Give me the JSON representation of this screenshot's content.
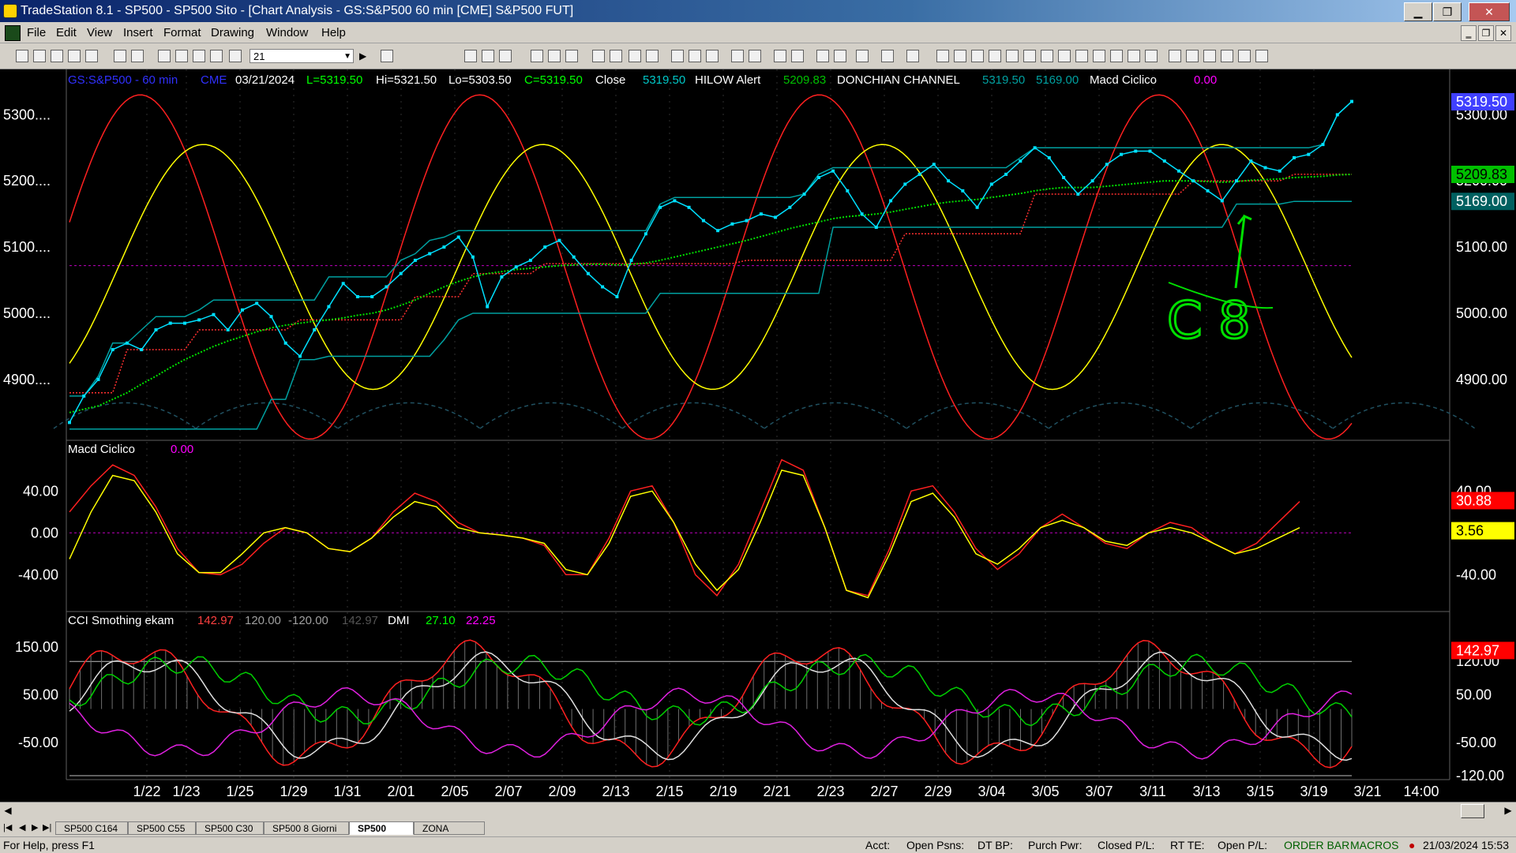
{
  "window": {
    "title": "TradeStation 8.1 - SP500 - SP500 Sito - [Chart Analysis - GS:S&P500  60 min  [CME] S&P500 FUT]",
    "min_label": "▁",
    "max_label": "❐",
    "close_label": "✕"
  },
  "menu": [
    "File",
    "Edit",
    "View",
    "Insert",
    "Format",
    "Drawing",
    "Window",
    "Help"
  ],
  "mdi_controls": [
    "‗",
    "❐",
    "✕"
  ],
  "toolbar": {
    "interval_value": "21"
  },
  "header": {
    "symbol": "GS:S&P500 - 60 min",
    "exchange": "CME",
    "date": "03/21/2024",
    "low_last": "L=5319.50",
    "hi": "Hi=5321.50",
    "lo": "Lo=5303.50",
    "close_eq": "C=5319.50",
    "close_label": "Close",
    "close_val": "5319.50",
    "hilow_label": "HILOW Alert",
    "hilow_val": "5209.83",
    "donchian_label": "DONCHIAN CHANNEL",
    "donchian_hi": "5319.50",
    "donchian_lo": "5169.00",
    "macd_label": "Macd Ciclico",
    "macd_val": "0.00"
  },
  "panel2": {
    "label": "Macd Ciclico",
    "val": "0.00"
  },
  "panel3": {
    "label": "CCI Smothing ekam",
    "v1": "142.97",
    "v2": "120.00",
    "v3": "-120.00",
    "v4": "142.97",
    "dmi_label": "DMI",
    "dmi1": "27.10",
    "dmi2": "22.25"
  },
  "annotation": {
    "text": "C 8"
  },
  "chart_data": [
    {
      "type": "line",
      "panel": "price",
      "x_labels": [
        "1/22",
        "1/23",
        "1/25",
        "1/29",
        "1/31",
        "2/01",
        "2/05",
        "2/07",
        "2/09",
        "2/13",
        "2/15",
        "2/19",
        "2/21",
        "2/23",
        "2/27",
        "2/29",
        "3/04",
        "3/05",
        "3/07",
        "3/11",
        "3/13",
        "3/15",
        "3/19",
        "3/21",
        "14:00"
      ],
      "y_ticks": [
        "5300....",
        "5200....",
        "5100....",
        "5000....",
        "4900...."
      ],
      "right_ticks": [
        "5300.00",
        "5200.00",
        "5100.00",
        "5000.00",
        "4900.00"
      ],
      "markers": [
        {
          "label": "5319.50",
          "color": "#4040ff"
        },
        {
          "label": "5209.83",
          "color": "#00c000"
        },
        {
          "label": "5169.00",
          "color": "#006060"
        }
      ],
      "ylim": [
        4820,
        5335
      ],
      "close": [
        4835,
        4875,
        4900,
        4945,
        4955,
        4945,
        4975,
        4985,
        4985,
        4990,
        4998,
        4975,
        5005,
        5015,
        4995,
        4955,
        4935,
        4975,
        5010,
        5045,
        5025,
        5025,
        5040,
        5060,
        5080,
        5090,
        5100,
        5115,
        5085,
        5010,
        5055,
        5070,
        5080,
        5100,
        5110,
        5085,
        5060,
        5040,
        5025,
        5080,
        5120,
        5160,
        5170,
        5160,
        5140,
        5125,
        5135,
        5140,
        5150,
        5145,
        5160,
        5180,
        5205,
        5215,
        5185,
        5150,
        5130,
        5170,
        5195,
        5210,
        5225,
        5200,
        5185,
        5160,
        5195,
        5210,
        5230,
        5250,
        5235,
        5205,
        5180,
        5200,
        5225,
        5240,
        5245,
        5245,
        5230,
        5215,
        5200,
        5185,
        5170,
        5200,
        5230,
        5220,
        5215,
        5235,
        5240,
        5255,
        5300,
        5320
      ],
      "donchian_upper": [
        4875,
        4875,
        4905,
        4955,
        4955,
        4975,
        4995,
        4995,
        4995,
        5005,
        5020,
        5020,
        5020,
        5020,
        5020,
        5020,
        5020,
        5020,
        5055,
        5055,
        5055,
        5055,
        5055,
        5080,
        5090,
        5110,
        5115,
        5125,
        5125,
        5125,
        5125,
        5125,
        5125,
        5125,
        5125,
        5125,
        5125,
        5125,
        5125,
        5125,
        5125,
        5165,
        5175,
        5175,
        5175,
        5175,
        5175,
        5175,
        5175,
        5175,
        5175,
        5180,
        5210,
        5220,
        5220,
        5220,
        5220,
        5220,
        5220,
        5220,
        5220,
        5220,
        5220,
        5220,
        5220,
        5220,
        5235,
        5250,
        5250,
        5250,
        5250,
        5250,
        5250,
        5250,
        5250,
        5250,
        5250,
        5250,
        5250,
        5250,
        5250,
        5250,
        5250,
        5250,
        5250,
        5250,
        5250,
        5255,
        5300,
        5320
      ],
      "donchian_lower": [
        4825,
        4825,
        4825,
        4825,
        4825,
        4825,
        4825,
        4825,
        4825,
        4825,
        4825,
        4825,
        4825,
        4825,
        4870,
        4870,
        4930,
        4930,
        4935,
        4935,
        4935,
        4935,
        4935,
        4935,
        4935,
        4935,
        4960,
        4990,
        5000,
        5000,
        5000,
        5000,
        5000,
        5000,
        5000,
        5000,
        5000,
        5000,
        5000,
        5000,
        5000,
        5030,
        5030,
        5030,
        5030,
        5030,
        5030,
        5030,
        5030,
        5030,
        5030,
        5030,
        5030,
        5130,
        5130,
        5130,
        5130,
        5130,
        5130,
        5130,
        5130,
        5130,
        5130,
        5130,
        5130,
        5130,
        5130,
        5130,
        5130,
        5130,
        5130,
        5130,
        5130,
        5130,
        5130,
        5130,
        5130,
        5130,
        5130,
        5130,
        5130,
        5165,
        5165,
        5165,
        5165,
        5169,
        5169,
        5169,
        5169,
        5169
      ],
      "hilow": [
        4880,
        4880,
        4880,
        4880,
        4945,
        4945,
        4945,
        4945,
        4945,
        4975,
        4975,
        4975,
        4975,
        4975,
        4975,
        4975,
        4990,
        4990,
        4990,
        4990,
        4990,
        4990,
        4990,
        4990,
        5025,
        5025,
        5025,
        5025,
        5060,
        5060,
        5060,
        5060,
        5060,
        5075,
        5075,
        5075,
        5075,
        5075,
        5075,
        5075,
        5075,
        5075,
        5075,
        5075,
        5075,
        5075,
        5075,
        5080,
        5080,
        5080,
        5080,
        5080,
        5080,
        5080,
        5080,
        5080,
        5080,
        5080,
        5120,
        5120,
        5120,
        5120,
        5120,
        5120,
        5120,
        5120,
        5120,
        5180,
        5180,
        5180,
        5180,
        5180,
        5180,
        5180,
        5180,
        5180,
        5180,
        5180,
        5200,
        5200,
        5200,
        5200,
        5200,
        5200,
        5200,
        5210,
        5210,
        5210,
        5210,
        5210
      ],
      "ma_green": [
        4850,
        4855,
        4860,
        4870,
        4880,
        4893,
        4905,
        4918,
        4930,
        4940,
        4950,
        4958,
        4965,
        4972,
        4978,
        4982,
        4985,
        4988,
        4990,
        4993,
        4997,
        5000,
        5005,
        5012,
        5020,
        5030,
        5040,
        5048,
        5055,
        5060,
        5063,
        5066,
        5068,
        5070,
        5072,
        5073,
        5074,
        5074,
        5073,
        5074,
        5076,
        5080,
        5085,
        5090,
        5095,
        5100,
        5105,
        5110,
        5116,
        5122,
        5128,
        5133,
        5138,
        5143,
        5146,
        5148,
        5150,
        5153,
        5157,
        5161,
        5165,
        5168,
        5170,
        5172,
        5175,
        5178,
        5181,
        5185,
        5188,
        5190,
        5190,
        5190,
        5192,
        5194,
        5196,
        5198,
        5200,
        5200,
        5200,
        5199,
        5198,
        5199,
        5201,
        5202,
        5203,
        5205,
        5206,
        5207,
        5209,
        5209.83
      ],
      "baseline": 5072
    },
    {
      "type": "line",
      "panel": "macd",
      "y_ticks": [
        "40.00",
        "0.00",
        "-40.00"
      ],
      "right_ticks": [
        "40.00",
        "-40.00"
      ],
      "markers": [
        {
          "label": "30.88",
          "color": "#ff0000"
        },
        {
          "label": "3.56",
          "color": "#ffff00"
        }
      ],
      "ylim": [
        -70,
        75
      ],
      "series": [
        {
          "color": "red",
          "values": [
            20,
            45,
            65,
            55,
            25,
            -15,
            -38,
            -40,
            -30,
            -10,
            5,
            0,
            -15,
            -18,
            -5,
            20,
            38,
            30,
            10,
            0,
            -2,
            -5,
            -12,
            -40,
            -40,
            -5,
            40,
            45,
            10,
            -40,
            -60,
            -30,
            20,
            70,
            60,
            5,
            -55,
            -60,
            -15,
            40,
            45,
            20,
            -15,
            -35,
            -20,
            5,
            18,
            5,
            -10,
            -15,
            0,
            10,
            5,
            -10,
            -20,
            -10,
            10,
            30
          ]
        },
        {
          "color": "yellow",
          "values": [
            -25,
            20,
            55,
            50,
            20,
            -20,
            -38,
            -38,
            -20,
            0,
            5,
            0,
            -15,
            -18,
            -5,
            15,
            30,
            25,
            5,
            0,
            -2,
            -5,
            -10,
            -35,
            -40,
            -10,
            35,
            40,
            10,
            -30,
            -55,
            -35,
            10,
            60,
            55,
            5,
            -55,
            -62,
            -20,
            30,
            38,
            15,
            -20,
            -30,
            -15,
            5,
            12,
            5,
            -8,
            -12,
            0,
            5,
            0,
            -10,
            -20,
            -15,
            -5,
            5
          ]
        }
      ]
    },
    {
      "type": "line",
      "panel": "cci_dmi",
      "y_ticks": [
        "150.00",
        "50.00",
        "-50.00"
      ],
      "right_ticks": [
        "120.00",
        "50.00",
        "-50.00",
        "-120.00"
      ],
      "markers": [
        {
          "label": "142.97",
          "color": "#ff0000"
        }
      ],
      "ylim": [
        -120,
        190
      ],
      "levels": [
        120,
        -120
      ]
    }
  ]
}
